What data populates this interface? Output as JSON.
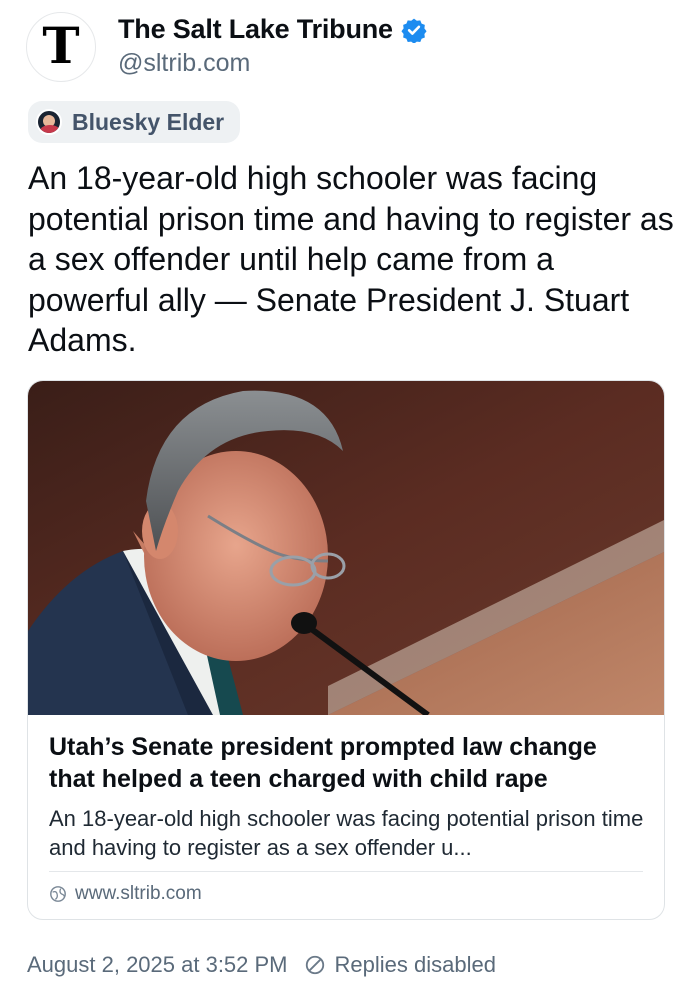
{
  "author": {
    "avatar_letter": "T",
    "display_name": "The Salt Lake Tribune",
    "handle": "@sltrib.com",
    "verified": true,
    "verified_color": "#1d8cf0"
  },
  "label": {
    "text": "Bluesky Elder",
    "icon": "elder-badge-icon"
  },
  "post": {
    "text": "An 18-year-old high schooler was facing potential prison time and having to register as a sex offender until help came from a powerful ally — Senate President J. Stuart Adams."
  },
  "link_card": {
    "image_alt": "photo",
    "title": "Utah’s Senate president prompted law change that helped a teen charged with child rape",
    "description": "An 18-year-old high schooler was facing potential prison time and having to register as a sex offender u...",
    "domain": "www.sltrib.com",
    "domain_icon": "globe-icon"
  },
  "meta": {
    "timestamp": "August 2, 2025 at 3:52 PM",
    "replies_status": "Replies disabled",
    "replies_icon": "ban-icon"
  },
  "colors": {
    "text_primary": "#0b0f14",
    "text_secondary": "#5a6a7a",
    "label_bg": "#eef1f3",
    "verified": "#1d8cf0"
  }
}
